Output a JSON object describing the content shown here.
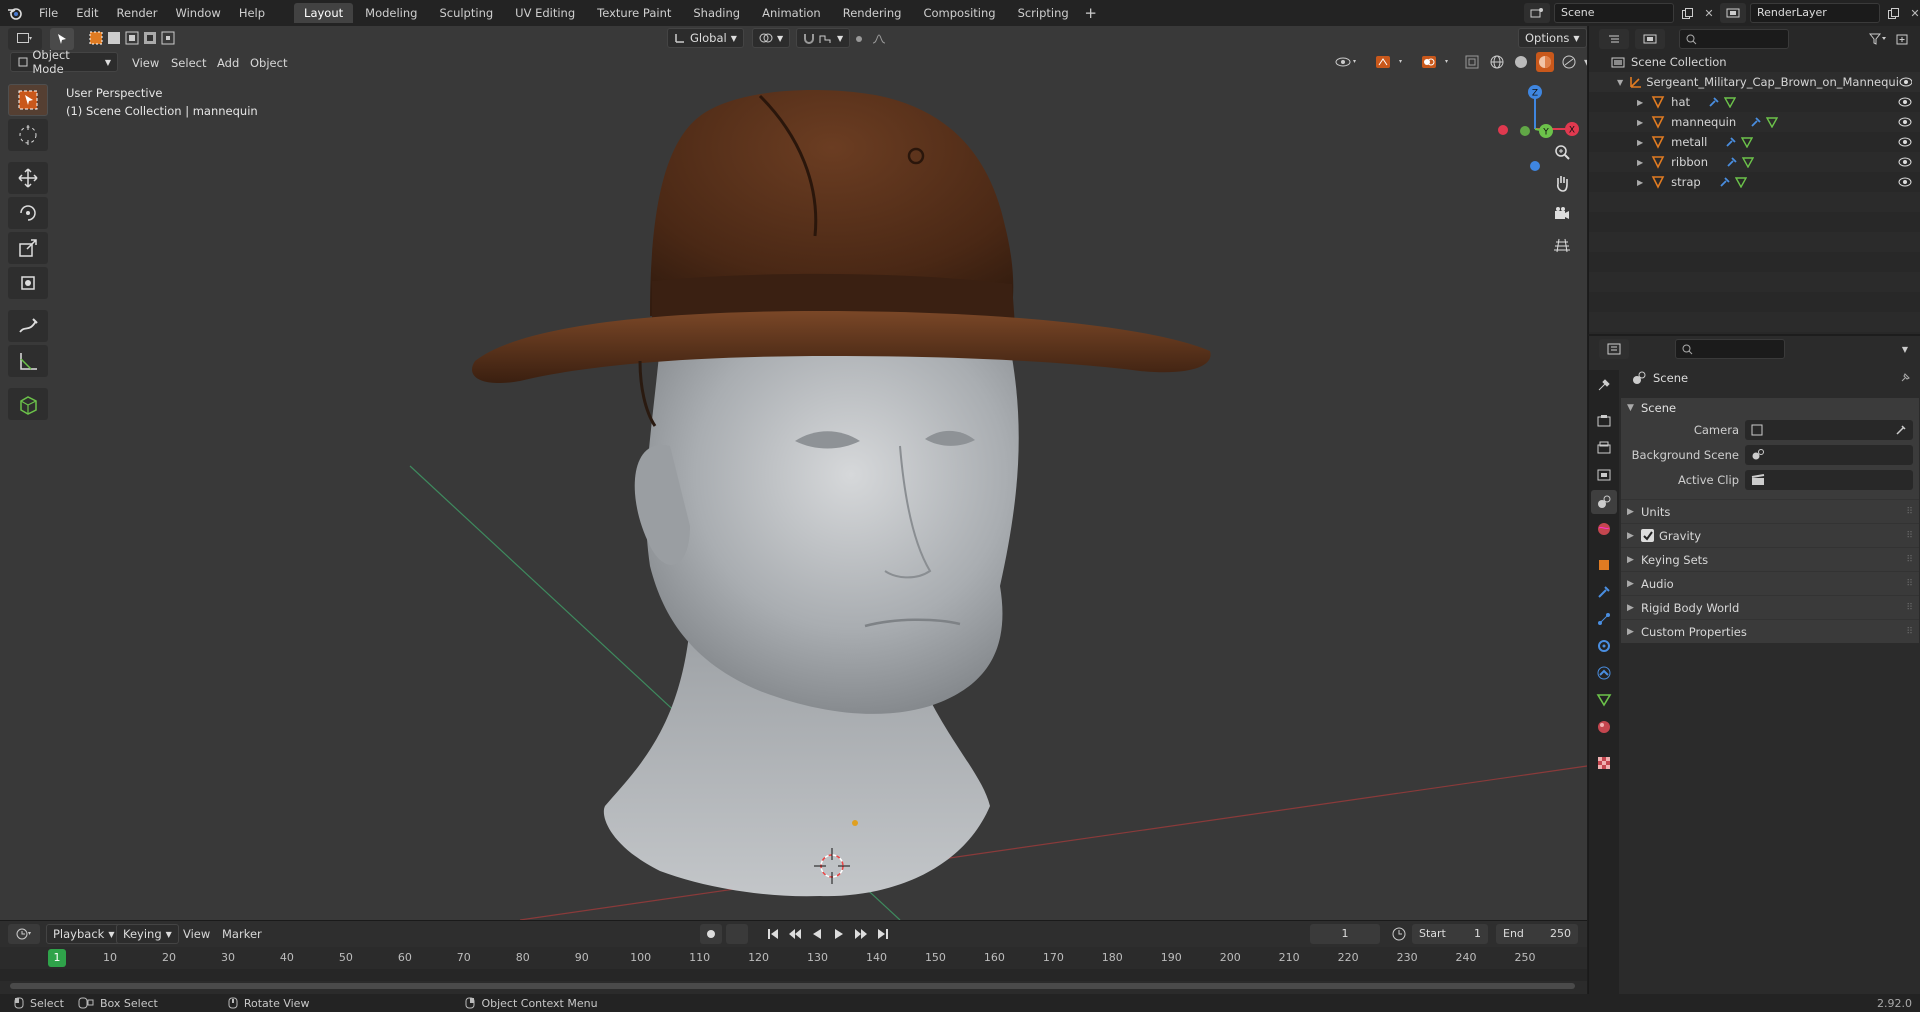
{
  "menu": [
    "File",
    "Edit",
    "Render",
    "Window",
    "Help"
  ],
  "workspaces": [
    "Layout",
    "Modeling",
    "Sculpting",
    "UV Editing",
    "Texture Paint",
    "Shading",
    "Animation",
    "Rendering",
    "Compositing",
    "Scripting"
  ],
  "active_workspace": "Layout",
  "scene_name": "Scene",
  "view_layer": "RenderLayer",
  "viewport": {
    "mode": "Object Mode",
    "menus": [
      "View",
      "Select",
      "Add",
      "Object"
    ],
    "transform_orientation": "Global",
    "options_label": "Options",
    "overlay_line1": "User Perspective",
    "overlay_line2": "(1) Scene Collection | mannequin",
    "gizmo": {
      "x": "X",
      "y": "Y",
      "z": "Z"
    }
  },
  "outliner": {
    "root": "Scene Collection",
    "collection": "Sergeant_Military_Cap_Brown_on_Mannequi",
    "objects": [
      "hat",
      "mannequin",
      "metall",
      "ribbon",
      "strap"
    ]
  },
  "properties": {
    "context": "Scene",
    "panel_title": "Scene",
    "camera_label": "Camera",
    "background_label": "Background Scene",
    "clip_label": "Active Clip",
    "subpanels": [
      "Units",
      "Gravity",
      "Keying Sets",
      "Audio",
      "Rigid Body World",
      "Custom Properties"
    ],
    "gravity_checked": true
  },
  "timeline": {
    "menus": [
      "Playback",
      "Keying",
      "View",
      "Marker"
    ],
    "current_frame": "1",
    "start_label": "Start",
    "start": "1",
    "end_label": "End",
    "end": "250",
    "ticks": [
      "1",
      "10",
      "20",
      "30",
      "40",
      "50",
      "60",
      "70",
      "80",
      "90",
      "100",
      "110",
      "120",
      "130",
      "140",
      "150",
      "160",
      "170",
      "180",
      "190",
      "200",
      "210",
      "220",
      "230",
      "240",
      "250"
    ]
  },
  "status": {
    "select": "Select",
    "box_select": "Box Select",
    "rotate_view": "Rotate View",
    "context_menu": "Object Context Menu",
    "version": "2.92.0"
  },
  "colors": {
    "accent": "#e07b22",
    "active_frame": "#2fa34a",
    "x_axis": "#e0394f",
    "y_axis": "#6cc34a",
    "z_axis": "#3f86e0"
  }
}
